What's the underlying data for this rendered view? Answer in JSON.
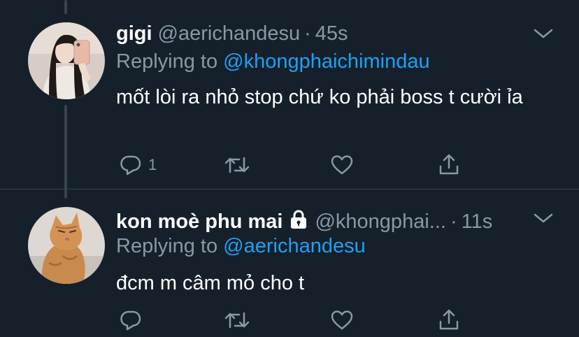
{
  "tweets": [
    {
      "display_name": "gigi",
      "handle": "@aerichandesu",
      "separator": "·",
      "time": "45s",
      "replying_prefix": "Replying to",
      "replying_to": "@khongphaichimindau",
      "text": "mốt lòi ra nhỏ stop chứ ko phải boss t cười ỉa",
      "reply_count": "1",
      "retweet_count": "",
      "like_count": ""
    },
    {
      "display_name": "kon moè phu mai",
      "handle": "@khongphai...",
      "separator": "·",
      "time": "11s",
      "replying_prefix": "Replying to",
      "replying_to": "@aerichandesu",
      "text": "đcm m câm mỏ cho t",
      "reply_count": "",
      "retweet_count": "",
      "like_count": ""
    }
  ],
  "icons": {
    "reply": "reply-icon",
    "retweet": "retweet-icon",
    "like": "heart-icon",
    "share": "share-icon",
    "more": "chevron-down-icon",
    "protected": "lock-icon"
  },
  "colors": {
    "background": "#15202b",
    "text_primary": "#ffffff",
    "text_secondary": "#8899a6",
    "accent": "#1da1f2",
    "border": "#38444d"
  }
}
